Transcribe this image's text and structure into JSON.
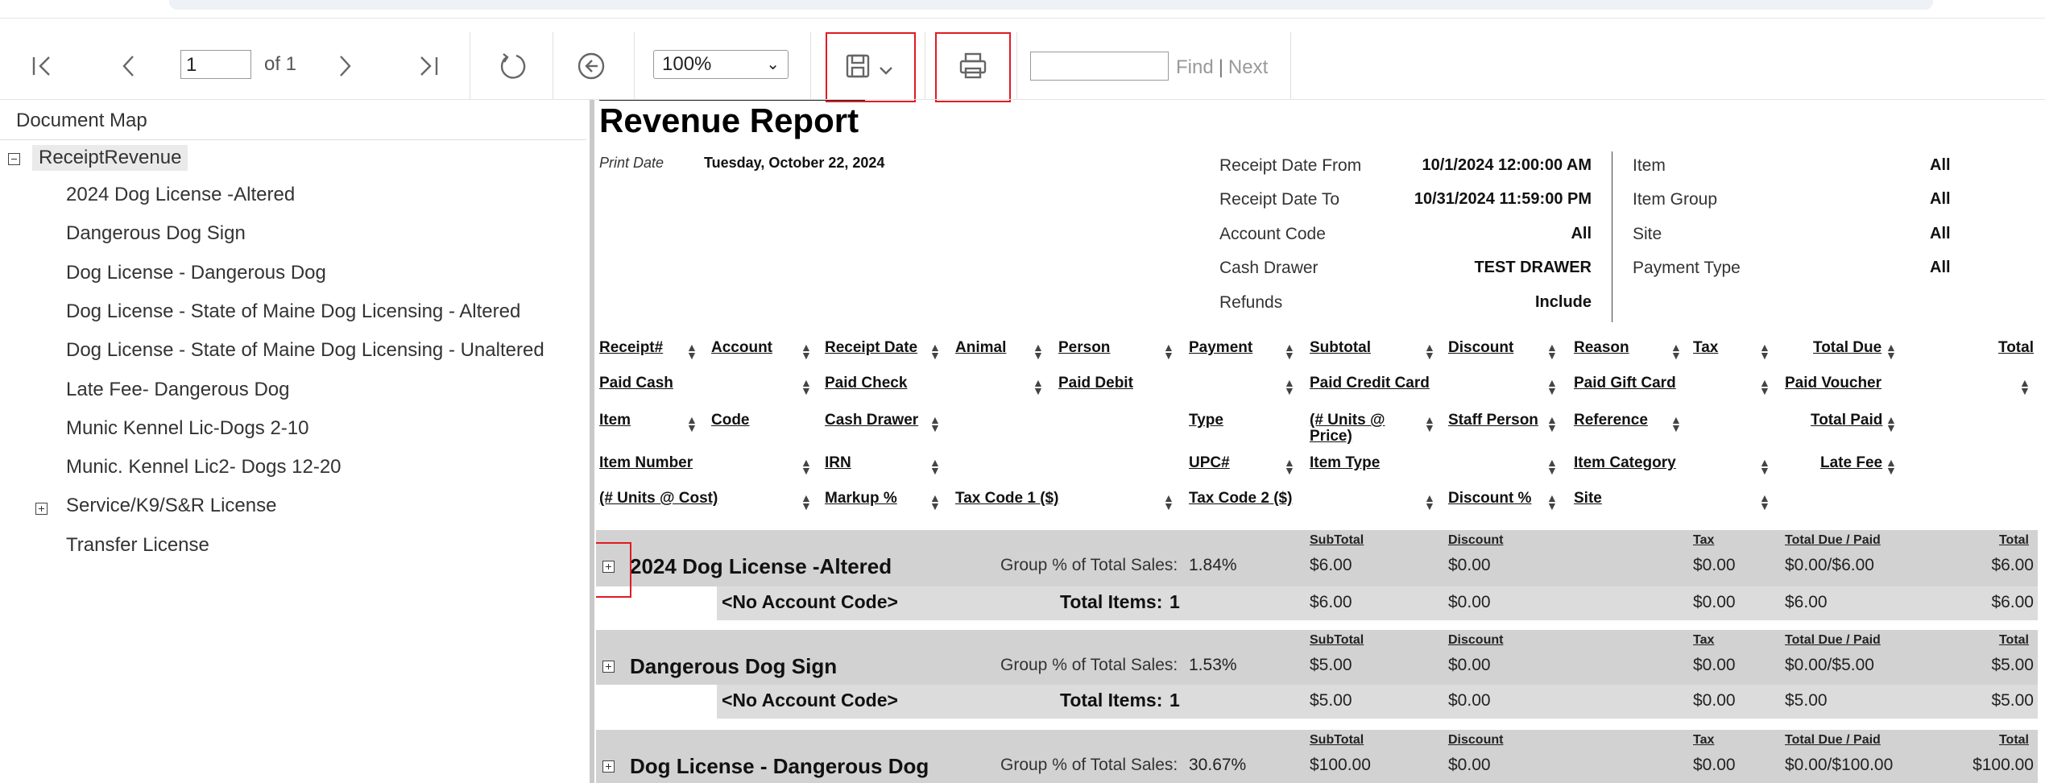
{
  "toolbar": {
    "page_value": "1",
    "page_of": "of 1",
    "zoom": "100%",
    "find_placeholder": "",
    "find_label": "Find",
    "find_sep": "|",
    "next_label": "Next",
    "icons": [
      "first-page-icon",
      "previous-page-icon",
      "next-page-icon",
      "last-page-icon",
      "refresh-icon",
      "back-icon",
      "save-icon",
      "chevron-down-icon",
      "print-icon"
    ]
  },
  "docmap": {
    "title": "Document Map",
    "root": "ReceiptRevenue",
    "items": [
      "2024 Dog License -Altered",
      "Dangerous Dog Sign",
      "Dog License - Dangerous Dog",
      "Dog License - State of Maine Dog Licensing - Altered",
      "Dog License - State of Maine Dog Licensing - Unaltered",
      "Late Fee- Dangerous Dog",
      "Munic Kennel Lic-Dogs 2-10",
      "Munic. Kennel Lic2- Dogs 12-20",
      "Service/K9/S&R License",
      "Transfer License"
    ]
  },
  "report": {
    "title": "Revenue Report",
    "print_date_label": "Print Date",
    "print_date_value": "Tuesday, October 22, 2024",
    "criteria_left": [
      {
        "label": "Receipt Date From",
        "value": "10/1/2024 12:00:00 AM"
      },
      {
        "label": "Receipt Date To",
        "value": "10/31/2024 11:59:00 PM"
      },
      {
        "label": "Account Code",
        "value": "All"
      },
      {
        "label": "Cash Drawer",
        "value": "TEST DRAWER"
      },
      {
        "label": "Refunds",
        "value": "Include"
      }
    ],
    "criteria_right": [
      {
        "label": "Item",
        "value": "All"
      },
      {
        "label": "Item Group",
        "value": "All"
      },
      {
        "label": "Site",
        "value": "All"
      },
      {
        "label": "Payment Type",
        "value": "All"
      }
    ],
    "headers": {
      "row1": [
        "Receipt#",
        "Account",
        "Receipt Date",
        "Animal",
        "Person",
        "Payment",
        "Subtotal",
        "Discount",
        "Reason",
        "Tax",
        "Total Due",
        "Total"
      ],
      "row2": [
        "Paid Cash",
        "Paid Check",
        "Paid Debit",
        "Paid Credit Card",
        "Paid Gift Card",
        "Paid Voucher"
      ],
      "row3": [
        "Item",
        "Code",
        "Cash Drawer",
        "Type",
        "(# Units @",
        "Price)",
        "Staff Person",
        "Reference",
        "Total Paid"
      ],
      "row4": [
        "Item Number",
        "IRN",
        "UPC#",
        "Item Type",
        "Item Category",
        "Late Fee"
      ],
      "row5": [
        "(# Units @ Cost)",
        "Markup %",
        "Tax Code 1 ($)",
        "Tax Code 2 ($)",
        "Discount %",
        "Site"
      ]
    },
    "group_labels": {
      "pct_label": "Group % of Total Sales:",
      "subtotal": "SubTotal",
      "discount": "Discount",
      "tax": "Tax",
      "total_due_paid": "Total Due / Paid",
      "total": "Total",
      "no_account": "<No Account Code>",
      "total_items_label": "Total Items:"
    },
    "groups": [
      {
        "name": "2024 Dog License -Altered",
        "pct": "1.84%",
        "subtotal": "$6.00",
        "discount": "$0.00",
        "tax": "$0.00",
        "due_paid": "$0.00/$6.00",
        "total": "$6.00",
        "sub": {
          "items": "1",
          "subtotal": "$6.00",
          "discount": "$0.00",
          "tax": "$0.00",
          "due": "$6.00",
          "total": "$6.00"
        }
      },
      {
        "name": "Dangerous Dog Sign",
        "pct": "1.53%",
        "subtotal": "$5.00",
        "discount": "$0.00",
        "tax": "$0.00",
        "due_paid": "$0.00/$5.00",
        "total": "$5.00",
        "sub": {
          "items": "1",
          "subtotal": "$5.00",
          "discount": "$0.00",
          "tax": "$0.00",
          "due": "$5.00",
          "total": "$5.00"
        }
      },
      {
        "name": "Dog License - Dangerous Dog",
        "pct": "30.67%",
        "subtotal": "$100.00",
        "discount": "$0.00",
        "tax": "$0.00",
        "due_paid": "$0.00/$100.00",
        "total": "$100.00"
      }
    ]
  }
}
